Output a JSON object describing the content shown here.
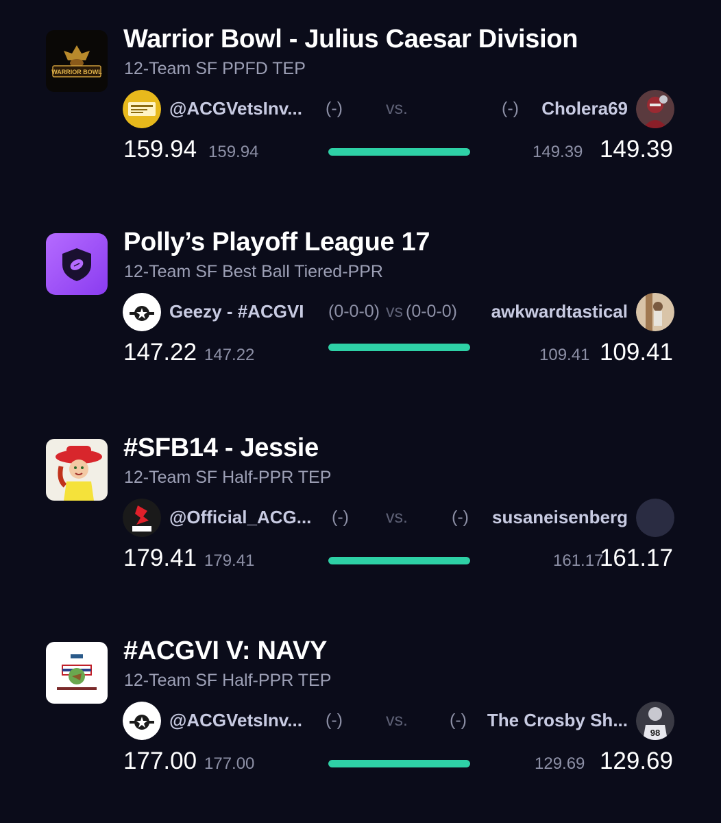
{
  "accent_color": "#2ed1a6",
  "background_color": "#0b0c1a",
  "matchups": [
    {
      "league_title": "Warrior Bowl - Julius Caesar Division",
      "league_subtitle": "12-Team SF PPFD TEP",
      "logo_icon": "warrior-bowl-logo",
      "logo_text": "WARRIOR BOWL",
      "home": {
        "name": "@ACGVetsInv...",
        "record": "(-)",
        "avatar_icon": "gold-plaque-avatar",
        "score": "159.94",
        "projected": "159.94"
      },
      "vs_label": "vs.",
      "away": {
        "name": "Cholera69",
        "record": "(-)",
        "avatar_icon": "football-player-avatar",
        "score": "149.39",
        "projected": "149.39"
      },
      "progress": 1.0
    },
    {
      "league_title": "Polly’s Playoff League 17",
      "league_subtitle": "12-Team SF Best Ball Tiered-PPR",
      "logo_icon": "football-shield-logo",
      "home": {
        "name": "Geezy - #ACGVI",
        "record": "(0-0-0)",
        "avatar_icon": "acg-star-avatar",
        "score": "147.22",
        "projected": "147.22"
      },
      "vs_label": "vs",
      "away": {
        "name": "awkwardtastical",
        "record": "(0-0-0)",
        "avatar_icon": "person-photo-avatar",
        "score": "109.41",
        "projected": "109.41"
      },
      "progress": 1.0
    },
    {
      "league_title": "#SFB14 - Jessie",
      "league_subtitle": "12-Team SF Half-PPR TEP",
      "logo_icon": "jessie-cowgirl-logo",
      "home": {
        "name": "@Official_ACG...",
        "record": "(-)",
        "avatar_icon": "acg-red-logo-avatar",
        "score": "179.41",
        "projected": "179.41"
      },
      "vs_label": "vs.",
      "away": {
        "name": "susaneisenberg",
        "record": "(-)",
        "avatar_icon": "blank-avatar",
        "score": "161.17",
        "projected": "161.17"
      },
      "progress": 1.0
    },
    {
      "league_title": "#ACGVI V: NAVY",
      "league_subtitle": "12-Team SF Half-PPR TEP",
      "logo_icon": "acg-veterans-invitational-logo",
      "home": {
        "name": "@ACGVetsInv...",
        "record": "(-)",
        "avatar_icon": "acg-star-avatar",
        "score": "177.00",
        "projected": "177.00"
      },
      "vs_label": "vs.",
      "away": {
        "name": "The Crosby Sh...",
        "record": "(-)",
        "avatar_icon": "jersey-98-player-avatar",
        "score": "129.69",
        "projected": "129.69"
      },
      "progress": 1.0
    }
  ]
}
